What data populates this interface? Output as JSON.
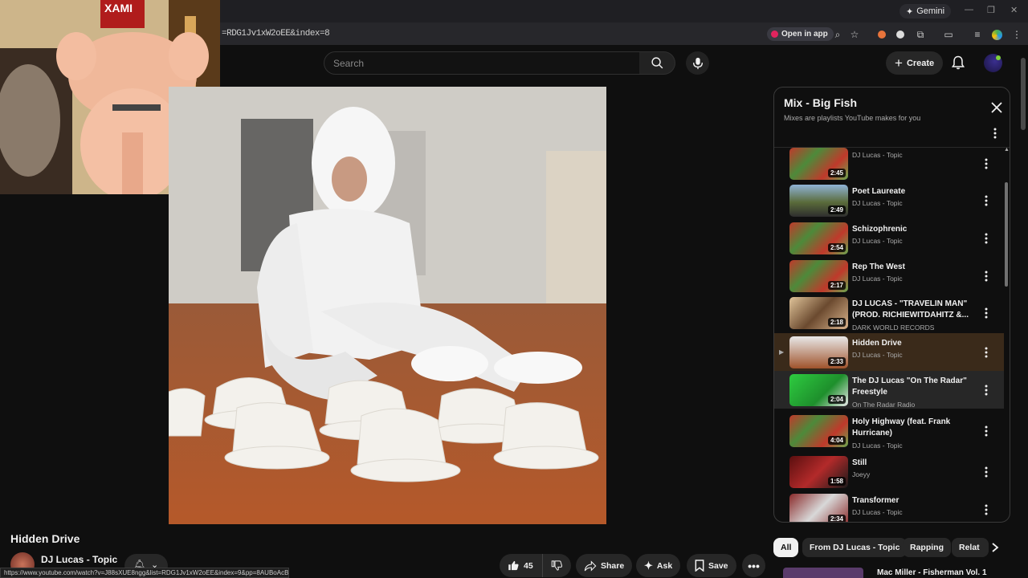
{
  "browser": {
    "gemini_label": "Gemini",
    "url_fragment": "=RDG1Jv1xW2oEE&index=8",
    "open_in_app": "Open in app",
    "status_url": "https://www.youtube.com/watch?v=J88sXUE8ngg&list=RDG1Jv1xW2oEE&index=9&pp=8AUBoAcB"
  },
  "header": {
    "search_placeholder": "Search",
    "create_label": "Create"
  },
  "panel": {
    "title": "Mix - Big Fish",
    "subtitle": "Mixes are playlists YouTube makes for you",
    "items": [
      {
        "title": "",
        "channel": "DJ Lucas - Topic",
        "duration": "2:45",
        "thumb": "album"
      },
      {
        "title": "Poet Laureate",
        "channel": "DJ Lucas - Topic",
        "duration": "2:49",
        "thumb": "crowd"
      },
      {
        "title": "Schizophrenic",
        "channel": "DJ Lucas - Topic",
        "duration": "2:54",
        "thumb": "album"
      },
      {
        "title": "Rep The West",
        "channel": "DJ Lucas - Topic",
        "duration": "2:17",
        "thumb": "album"
      },
      {
        "title": "DJ LUCAS - \"TRAVELIN MAN\" (PROD. RICHIEWITDAHITZ &...",
        "channel": "DARK WORLD RECORDS",
        "duration": "2:18",
        "thumb": "people"
      },
      {
        "title": "Hidden Drive",
        "channel": "DJ Lucas - Topic",
        "duration": "2:33",
        "thumb": "white"
      },
      {
        "title": "The DJ Lucas \"On The Radar\" Freestyle",
        "channel": "On The Radar Radio",
        "duration": "2:04",
        "thumb": "green"
      },
      {
        "title": "Holy Highway (feat. Frank Hurricane)",
        "channel": "DJ Lucas - Topic",
        "duration": "4:04",
        "thumb": "album"
      },
      {
        "title": "Still",
        "channel": "Joeyy",
        "duration": "1:58",
        "thumb": "red"
      },
      {
        "title": "Transformer",
        "channel": "DJ Lucas - Topic",
        "duration": "2:34",
        "thumb": "sign"
      }
    ]
  },
  "chips": [
    "All",
    "From DJ Lucas - Topic",
    "Rapping",
    "Relat"
  ],
  "video": {
    "title": "Hidden Drive",
    "channel": "DJ Lucas - Topic",
    "likes": "45",
    "share": "Share",
    "ask": "Ask",
    "save": "Save"
  },
  "up_next": {
    "title": "Mac Miller - Fisherman Vol. 1"
  },
  "webcam_sign": "XAMI",
  "colors": {
    "accent_red": "#e0245e",
    "active_row": "#3a2a1a"
  }
}
